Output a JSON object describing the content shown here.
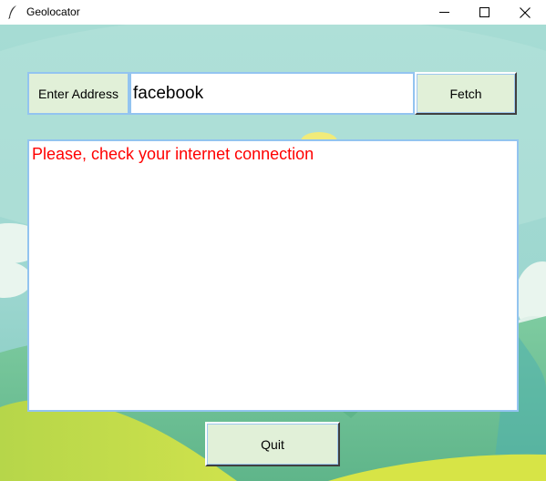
{
  "window": {
    "title": "Geolocator",
    "minimize_icon": "minimize-icon",
    "maximize_icon": "maximize-icon",
    "close_icon": "close-icon"
  },
  "form": {
    "address_label": "Enter Address",
    "address_value": "facebook",
    "fetch_label": "Fetch"
  },
  "output": {
    "message": "Please, check your internet connection",
    "message_color": "#ff0000"
  },
  "footer": {
    "quit_label": "Quit"
  },
  "theme": {
    "button_bg": "#e1f0d8",
    "border_color": "#93c4f0",
    "sky_color": "#a7dcd3",
    "hill_color": "#8cc56a"
  }
}
